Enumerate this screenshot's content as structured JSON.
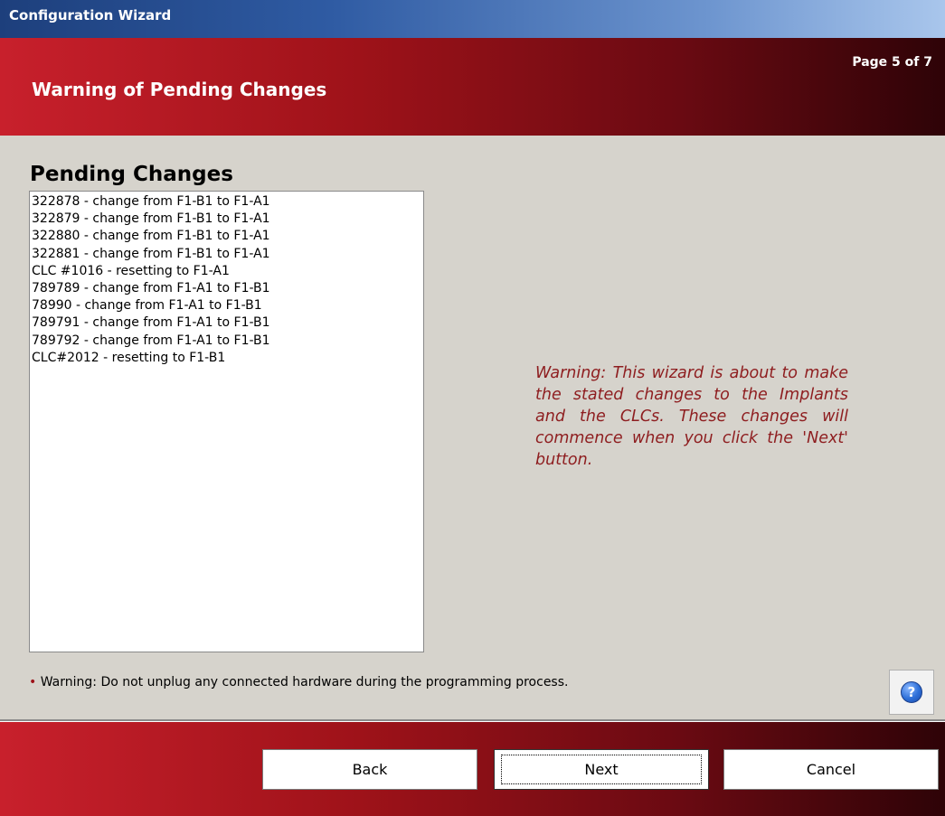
{
  "window": {
    "title": "Configuration Wizard"
  },
  "header": {
    "title": "Warning of Pending Changes",
    "page_indicator": "Page 5 of 7"
  },
  "main": {
    "section_title": "Pending Changes",
    "pending_changes": [
      "322878 - change from F1-B1 to F1-A1",
      "322879 - change from F1-B1 to F1-A1",
      "322880 - change from F1-B1 to F1-A1",
      "322881 - change from F1-B1 to F1-A1",
      "CLC #1016 - resetting to F1-A1",
      "789789 - change from F1-A1 to F1-B1",
      "78990 - change from F1-A1 to F1-B1",
      "789791 - change from F1-A1 to F1-B1",
      "789792 - change from F1-A1 to F1-B1",
      "CLC#2012 - resetting to F1-B1"
    ],
    "warning_text": "Warning: This wizard is about to make the stated changes to the Implants and the CLCs.  These changes will commence when you click the 'Next' button.",
    "hardware_warning": {
      "bullet": "•",
      "text": "Warning: Do not unplug any connected hardware during the programming process."
    },
    "help_icon": "help-icon"
  },
  "footer": {
    "back_label": "Back",
    "next_label": "Next",
    "cancel_label": "Cancel"
  },
  "colors": {
    "titlebar_left": "#1d3f7c",
    "titlebar_right": "#a9c6ec",
    "header_left": "#c8202c",
    "header_right": "#2e0307",
    "warning_text": "#8e1d1f",
    "background": "#d6d3cc"
  }
}
